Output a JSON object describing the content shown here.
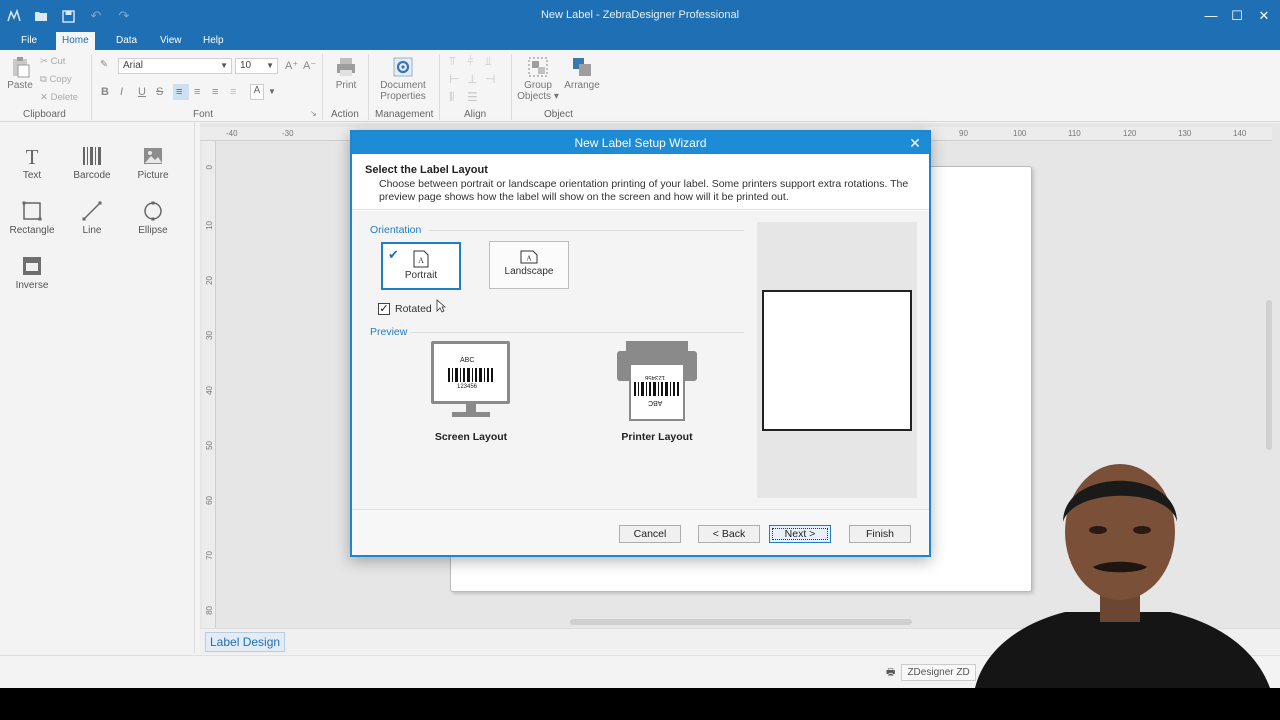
{
  "window": {
    "title": "New Label - ZebraDesigner Professional",
    "minimize": "—",
    "maximize": "☐",
    "close": "✕"
  },
  "ribbon_tabs": [
    "File",
    "Home",
    "Data",
    "View",
    "Help"
  ],
  "ribbon": {
    "clipboard": {
      "paste": "Paste",
      "cut": "Cut",
      "copy": "Copy",
      "delete": "Delete",
      "group": "Clipboard"
    },
    "font": {
      "family": "Arial",
      "size": "10",
      "group": "Font",
      "bold": "B",
      "italic": "I",
      "underline": "U",
      "strike": "S",
      "color": "A"
    },
    "action": {
      "print": "Print",
      "group": "Action"
    },
    "management": {
      "doc_props_line1": "Document",
      "doc_props_line2": "Properties",
      "group": "Management"
    },
    "align": {
      "group": "Align"
    },
    "object": {
      "group_objects_line1": "Group",
      "group_objects_line2": "Objects ▾",
      "arrange": "Arrange",
      "group": "Object"
    }
  },
  "toolbox": [
    {
      "label": "Text"
    },
    {
      "label": "Barcode"
    },
    {
      "label": "Picture"
    },
    {
      "label": "Rectangle"
    },
    {
      "label": "Line"
    },
    {
      "label": "Ellipse"
    },
    {
      "label": "Inverse"
    }
  ],
  "ruler_h": [
    "-40",
    "-30",
    "90",
    "100",
    "110",
    "120",
    "130",
    "140"
  ],
  "ruler_v": [
    "0",
    "10",
    "20",
    "30",
    "40",
    "50",
    "60",
    "70",
    "80"
  ],
  "bottom": {
    "label_tab": "Label Design",
    "printer": "ZDesigner ZD"
  },
  "dialog": {
    "title": "New Label Setup Wizard",
    "close": "✕",
    "heading": "Select the Label Layout",
    "description": "Choose between portrait or landscape orientation printing of your label. Some printers support extra rotations. The preview page shows how the label will show on the screen and how will it be printed out.",
    "orientation_label": "Orientation",
    "portrait": "Portrait",
    "landscape": "Landscape",
    "rotated": "Rotated",
    "rotated_checked": true,
    "preview_label": "Preview",
    "screen_layout": "Screen Layout",
    "printer_layout": "Printer Layout",
    "barcode_text_top": "ABC",
    "barcode_text_bottom": "123456",
    "buttons": {
      "cancel": "Cancel",
      "back": "< Back",
      "next": "Next >",
      "finish": "Finish"
    }
  },
  "colors": {
    "accent": "#1e6fb4",
    "dialog_title": "#1e8bd6",
    "section": "#1e7fc4"
  }
}
